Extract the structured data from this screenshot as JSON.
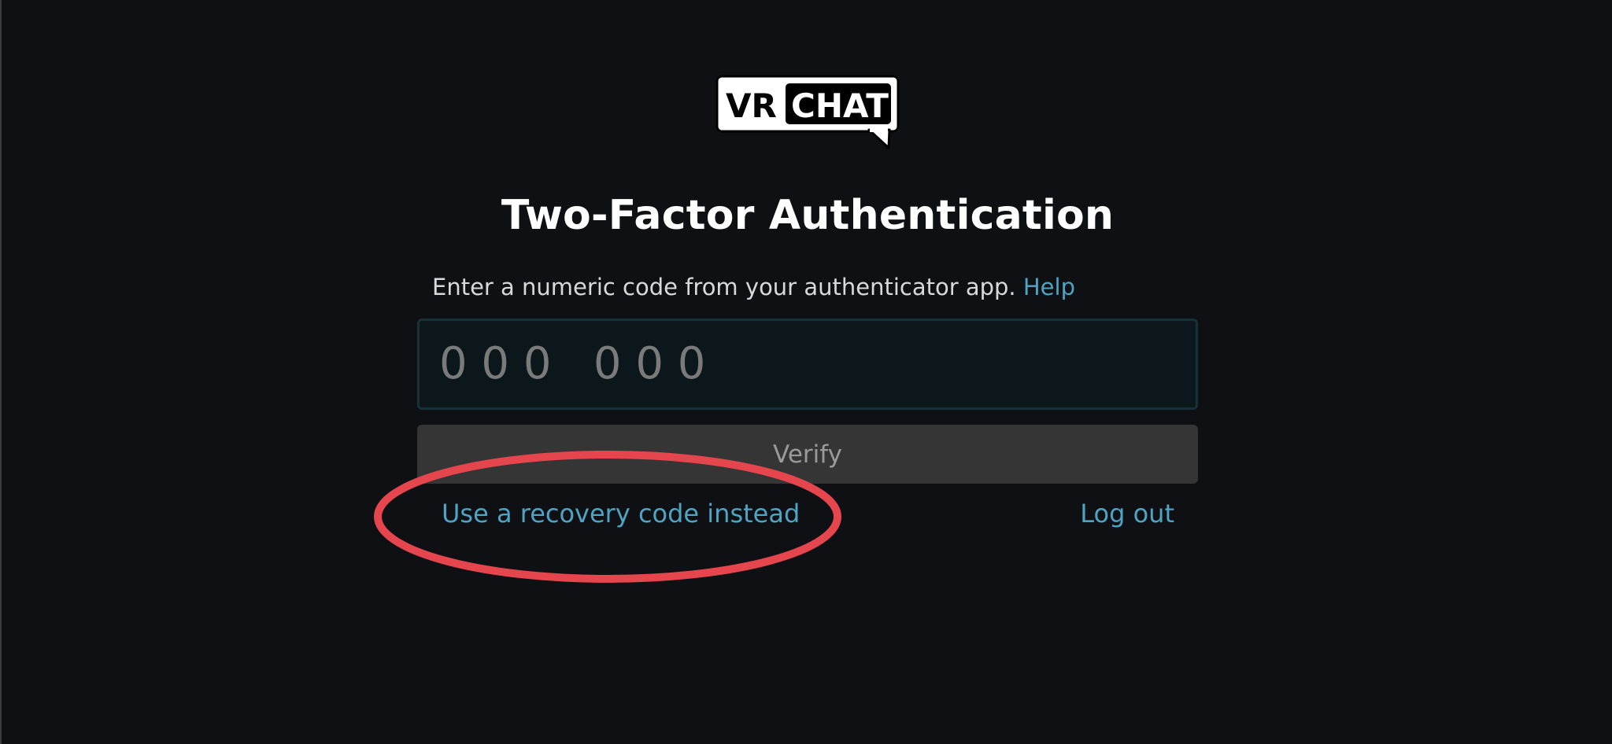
{
  "logo": {
    "text_left": "VR",
    "text_right": "CHAT"
  },
  "title": "Two-Factor Authentication",
  "instruction": {
    "text": "Enter a numeric code from your authenticator app.",
    "help_label": "Help"
  },
  "code_input": {
    "value": "",
    "placeholder": "0 0 0   0 0 0"
  },
  "verify_button": {
    "label": "Verify"
  },
  "links": {
    "recovery": "Use a recovery code instead",
    "logout": "Log out"
  },
  "colors": {
    "background": "#0f1013",
    "link": "#4fa3c3",
    "annotation": "#e5464e"
  },
  "annotation": {
    "shape": "ellipse",
    "highlights": "recovery-link"
  }
}
